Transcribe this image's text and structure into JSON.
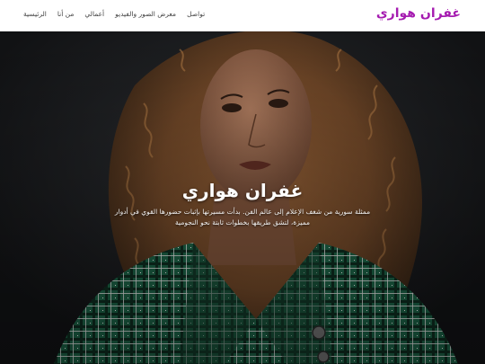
{
  "brand": {
    "name": "غفران هواري"
  },
  "nav": {
    "items": [
      {
        "label": "الرئيسية"
      },
      {
        "label": "من أنا"
      },
      {
        "label": "أعمالي"
      },
      {
        "label": "معرض الصور والفيديو"
      },
      {
        "label": "تواصل"
      }
    ]
  },
  "hero": {
    "title": "غفران هواري",
    "subtitle_line1": "ممثلة سورية من شغف الإعلام إلى عالم الفن. بدأت مسيرتها بإثبات حضورها القوي في أدوار",
    "subtitle_line2": "مميزة، لتشق طريقها بخطوات ثابتة نحو النجومية"
  },
  "colors": {
    "brand": "#a51bb0",
    "nav_text": "#444444",
    "hero_bg": "#17191c",
    "jacket_green": "#1f6b4c"
  }
}
